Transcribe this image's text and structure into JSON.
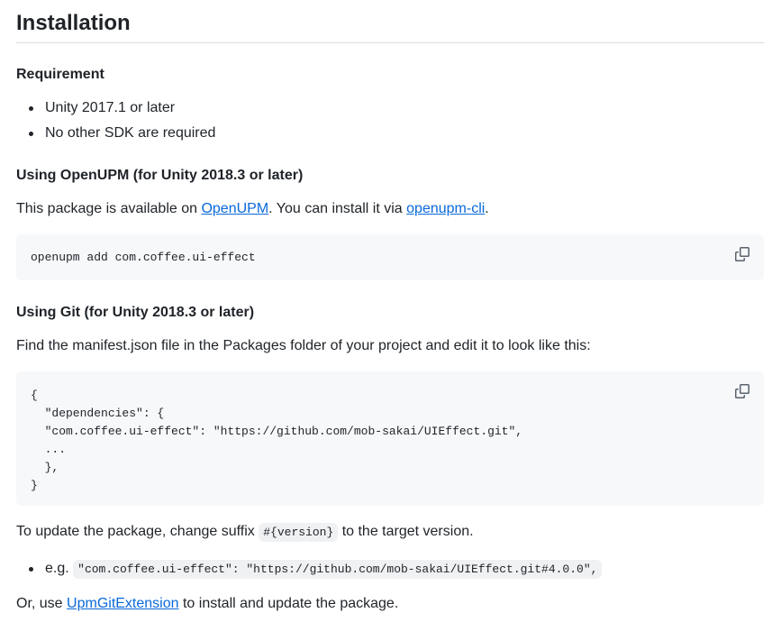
{
  "heading": "Installation",
  "requirement": {
    "title": "Requirement",
    "items": [
      "Unity 2017.1 or later",
      "No other SDK are required"
    ]
  },
  "openupm": {
    "title": "Using OpenUPM (for Unity 2018.3 or later)",
    "text_before": "This package is available on ",
    "link1": "OpenUPM",
    "text_middle": ". You can install it via ",
    "link2": "openupm-cli",
    "text_after": ".",
    "code": "openupm add com.coffee.ui-effect"
  },
  "git": {
    "title": "Using Git (for Unity 2018.3 or later)",
    "text": "Find the manifest.json file in the Packages folder of your project and edit it to look like this:",
    "code": "{\n  \"dependencies\": {\n  \"com.coffee.ui-effect\": \"https://github.com/mob-sakai/UIEffect.git\",\n  ...\n  },\n}"
  },
  "update": {
    "text_before": "To update the package, change suffix ",
    "suffix": "#{version}",
    "text_after": " to the target version.",
    "example_prefix": "e.g. ",
    "example_code": "\"com.coffee.ui-effect\": \"https://github.com/mob-sakai/UIEffect.git#4.0.0\","
  },
  "footer": {
    "text_before": "Or, use ",
    "link": "UpmGitExtension",
    "text_after": " to install and update the package."
  },
  "icons": {
    "copy": "copy-icon"
  }
}
